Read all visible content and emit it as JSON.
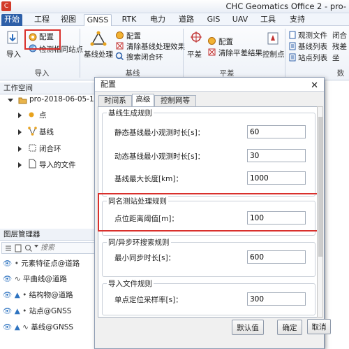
{
  "window": {
    "title": "CHC Geomatics Office 2 - pro-"
  },
  "menubar": {
    "start_tab": "开始",
    "tabs": [
      "工程",
      "视图",
      "GNSS",
      "RTK",
      "电力",
      "道路",
      "GIS",
      "UAV",
      "工具",
      "支持"
    ],
    "active_tab": "GNSS"
  },
  "ribbon": {
    "import": {
      "button": "导入",
      "config": "配置",
      "check_same_station": "检测相同站点",
      "group": "导入"
    },
    "baseline": {
      "process": "基线处理",
      "config": "配置",
      "clear_results": "清除基线处理效果",
      "search_loop": "搜索闭合环",
      "group": "基线"
    },
    "adjustment": {
      "adjust": "平差",
      "config": "配置",
      "clear_results": "清除平差结果",
      "control_point": "控制点",
      "group": "平差"
    },
    "reports": {
      "obs_file": "观测文件",
      "baseline_list": "基线列表",
      "station_list": "站点列表",
      "loop_partial": "闭合",
      "residual_partial": "残差",
      "extra_partial": "坐",
      "group_partial": "数"
    }
  },
  "workspace": {
    "header": "工作空间",
    "project": "pro-2018-06-05-13-4",
    "items": [
      "点",
      "基线",
      "闭合环",
      "导入的文件"
    ]
  },
  "layers": {
    "header": "图层管理器",
    "search_placeholder": "搜索",
    "items": [
      "元素特征点@道路",
      "平曲线@道路",
      "结构物@道路",
      "站点@GNSS",
      "基线@GNSS"
    ]
  },
  "dialog": {
    "title": "配置",
    "close": "✕",
    "tabs": [
      "时间系统",
      "高级",
      "控制网等级"
    ],
    "active_tab": "高级",
    "groups": [
      {
        "title": "基线生成规则",
        "fields": [
          {
            "label": "静态基线最小观测时长[s]：",
            "value": "60"
          },
          {
            "label": "动态基线最小观测时长[s]：",
            "value": "30"
          },
          {
            "label": "基线最大长度[km]：",
            "value": "1000"
          }
        ]
      },
      {
        "title": "同名测站处理规则",
        "fields": [
          {
            "label": "点位距离阈值[m]：",
            "value": "100"
          }
        ]
      },
      {
        "title": "同/异步环搜索规则",
        "fields": [
          {
            "label": "最小同步时长[s]：",
            "value": "600"
          }
        ]
      },
      {
        "title": "导入文件规则",
        "fields": [
          {
            "label": "单点定位采样率[s]：",
            "value": "300"
          }
        ]
      }
    ],
    "buttons": {
      "default": "默认值",
      "ok": "确定",
      "cancel": "取消"
    }
  },
  "colors": {
    "accent": "#2d5fa8",
    "highlight": "#d9302c",
    "point_dot": "#e8a21c",
    "layer_eye": "#2f74c0"
  }
}
